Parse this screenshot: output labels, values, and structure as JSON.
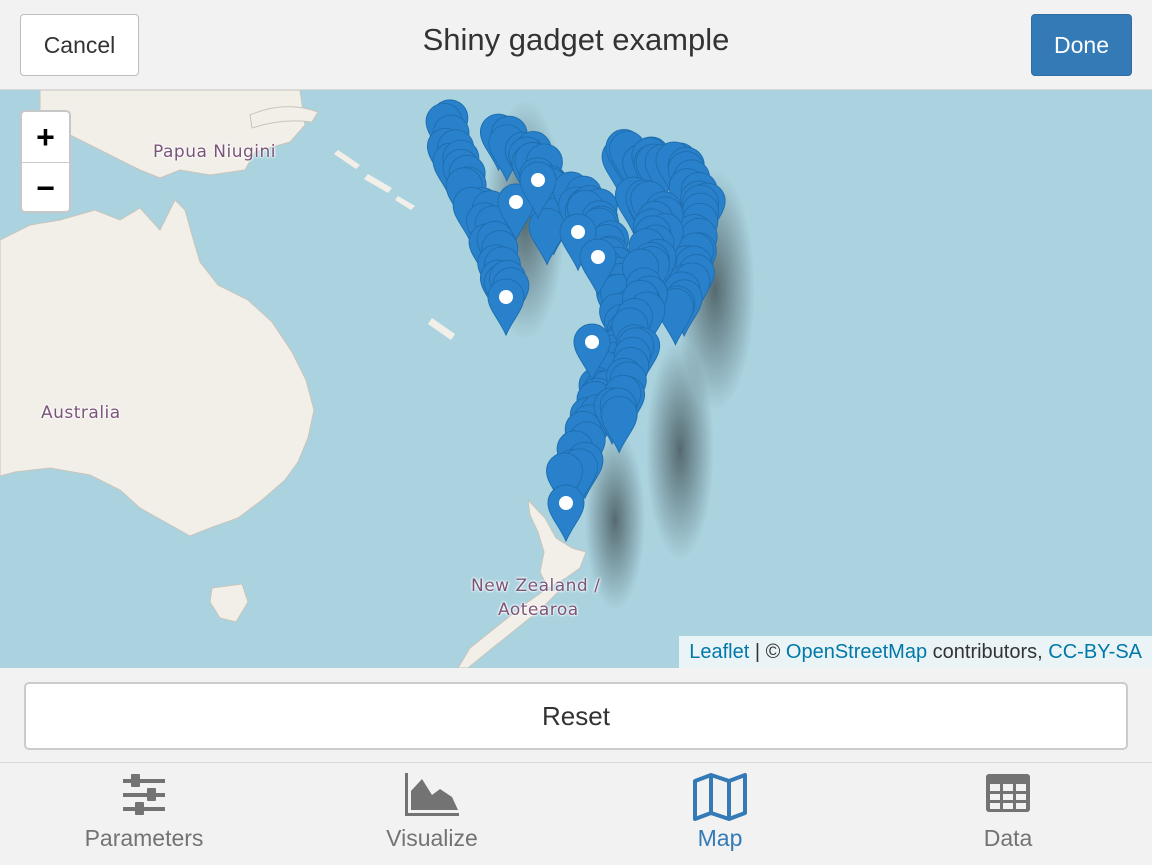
{
  "header": {
    "title": "Shiny gadget example",
    "cancel_label": "Cancel",
    "done_label": "Done"
  },
  "map": {
    "zoom_in_label": "+",
    "zoom_out_label": "−",
    "place_labels": {
      "papua": "Papua Niugini",
      "australia": "Australia",
      "nz_line1": "New Zealand /",
      "nz_line2": "Aotearoa"
    },
    "attribution": {
      "leaflet": "Leaflet",
      "separator": " | © ",
      "osm": "OpenStreetMap",
      "contributors": " contributors, ",
      "license": "CC-BY-SA"
    }
  },
  "reset_label": "Reset",
  "tabs": [
    {
      "label": "Parameters",
      "icon": "sliders-icon"
    },
    {
      "label": "Visualize",
      "icon": "area-chart-icon"
    },
    {
      "label": "Map",
      "icon": "map-icon",
      "active": true
    },
    {
      "label": "Data",
      "icon": "table-icon"
    }
  ],
  "colors": {
    "accent": "#337ab7",
    "water": "#aad3df",
    "land": "#f2efe9",
    "marker": "#2a81cb"
  }
}
